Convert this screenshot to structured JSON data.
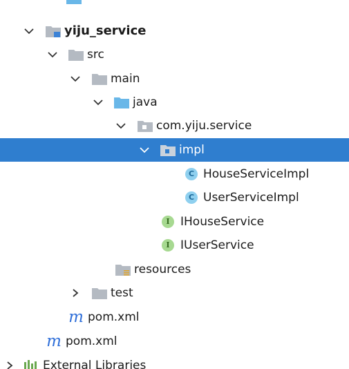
{
  "tree": {
    "partial_top_label": "",
    "project": {
      "label": "yiju_service"
    },
    "src": {
      "label": "src"
    },
    "main": {
      "label": "main"
    },
    "java": {
      "label": "java"
    },
    "package": {
      "label": "com.yiju.service"
    },
    "impl": {
      "label": "impl",
      "selected": true
    },
    "house_service_impl": {
      "label": "HouseServiceImpl",
      "badge": "C"
    },
    "user_service_impl": {
      "label": "UserServiceImpl",
      "badge": "C"
    },
    "ihouse_service": {
      "label": "IHouseService",
      "badge": "I"
    },
    "iuser_service": {
      "label": "IUserService",
      "badge": "I"
    },
    "resources": {
      "label": "resources"
    },
    "test": {
      "label": "test"
    },
    "module_pom": {
      "label": "pom.xml",
      "badge": "m"
    },
    "root_pom": {
      "label": "pom.xml",
      "badge": "m"
    },
    "external_libraries": {
      "label": "External Libraries"
    }
  },
  "colors": {
    "selection": "#2f7ecf",
    "folder_gray": "#b4bac2",
    "folder_blue": "#69b7e8",
    "maven_blue": "#2f6fd9",
    "class_badge": "#8fd0ef",
    "interface_badge": "#a7d991"
  }
}
